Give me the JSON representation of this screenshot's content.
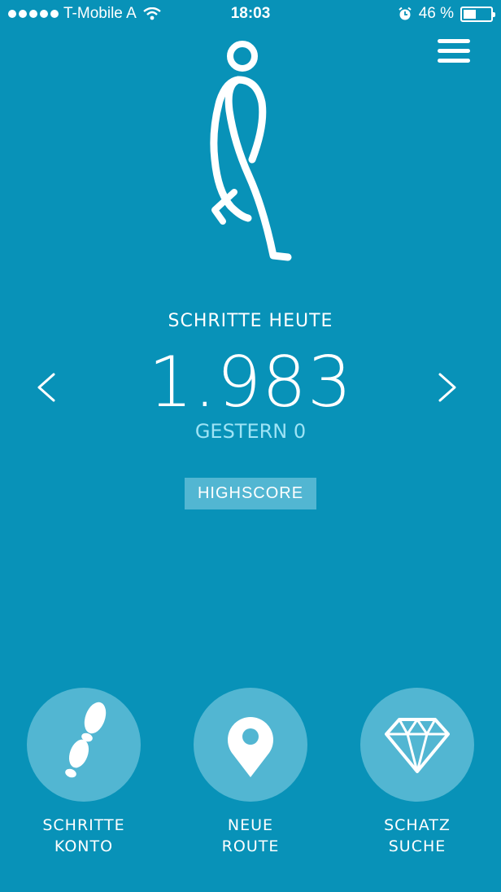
{
  "status_bar": {
    "carrier": "T-Mobile A",
    "time": "18:03",
    "battery_text": "46 %",
    "battery_level": 0.46,
    "icons": [
      "signal-dots-icon",
      "wifi-icon",
      "alarm-icon",
      "battery-icon"
    ]
  },
  "header": {
    "menu_icon": "hamburger-menu-icon",
    "figure_icon": "walking-person-icon"
  },
  "steps": {
    "label": "SCHRITTE HEUTE",
    "value": "1.983",
    "yesterday": "GESTERN 0",
    "prev_icon": "chevron-left-icon",
    "next_icon": "chevron-right-icon"
  },
  "highscore_label": "HIGHSCORE",
  "actions": [
    {
      "line1": "SCHRITTE",
      "line2": "KONTO",
      "icon": "footprints-icon"
    },
    {
      "line1": "NEUE",
      "line2": "ROUTE",
      "icon": "map-pin-icon"
    },
    {
      "line1": "SCHATZ",
      "line2": "SUCHE",
      "icon": "diamond-icon"
    }
  ],
  "colors": {
    "background": "#0892b8",
    "button_bg": "#52b6d2",
    "secondary_text": "#9de3f5"
  }
}
